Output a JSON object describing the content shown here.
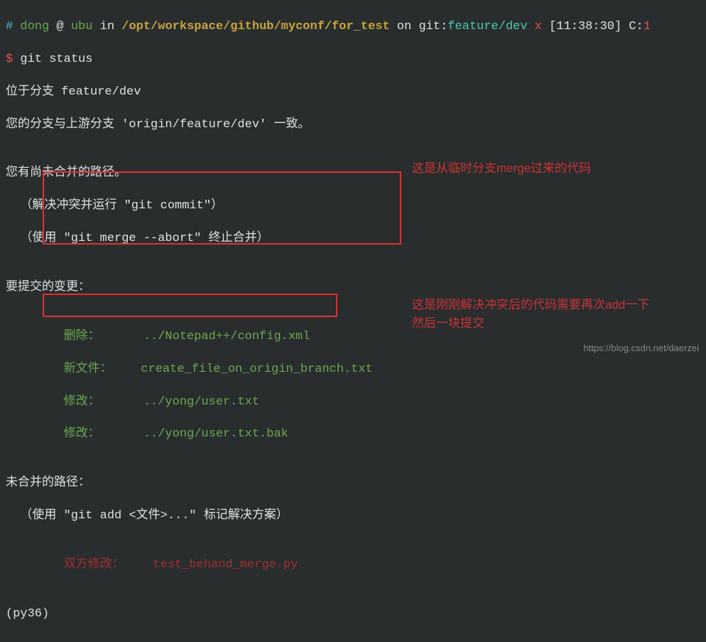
{
  "prompt": {
    "hash": "#",
    "user": "dong",
    "at": "@",
    "host": "ubu",
    "in": "in",
    "path": "/opt/workspace/github/myconf/for_test",
    "on": "on",
    "git_label": "git:",
    "branch": "feature/dev",
    "x": "x",
    "time": "[11:38:30]",
    "c_label": "C:",
    "c_num": "1",
    "dollar": "$",
    "command": "git status"
  },
  "output": {
    "line1": "位于分支 feature/dev",
    "line2a": "您的分支与上游分支 '",
    "line2b": "origin/feature/dev",
    "line2c": "' 一致。",
    "line_blank": "",
    "line3": "您有尚未合并的路径。",
    "line4": "  （解决冲突并运行 \"git commit\"）",
    "line5": "  （使用 \"git merge --abort\" 终止合并）",
    "line6": "要提交的变更：",
    "changes": {
      "del": "        删除：      ../Notepad++/config.xml",
      "new": "        新文件：    create_file_on_origin_branch.txt",
      "mod1": "        修改：      ../yong/user.txt",
      "mod2": "        修改：      ../yong/user.txt.bak"
    },
    "line7": "未合并的路径：",
    "line8": "  （使用 \"git add <文件>...\" 标记解决方案）",
    "unmerged": "        双方修改：    test_behand_merge.py",
    "venv": "(py36)"
  },
  "annotations": {
    "a1": "这是从临时分支merge过来的代码",
    "a2": "这是刚刚解决冲突后的代码需要再次add一下\n然后一块提交"
  },
  "watermark": "https://blog.csdn.net/daerzei"
}
